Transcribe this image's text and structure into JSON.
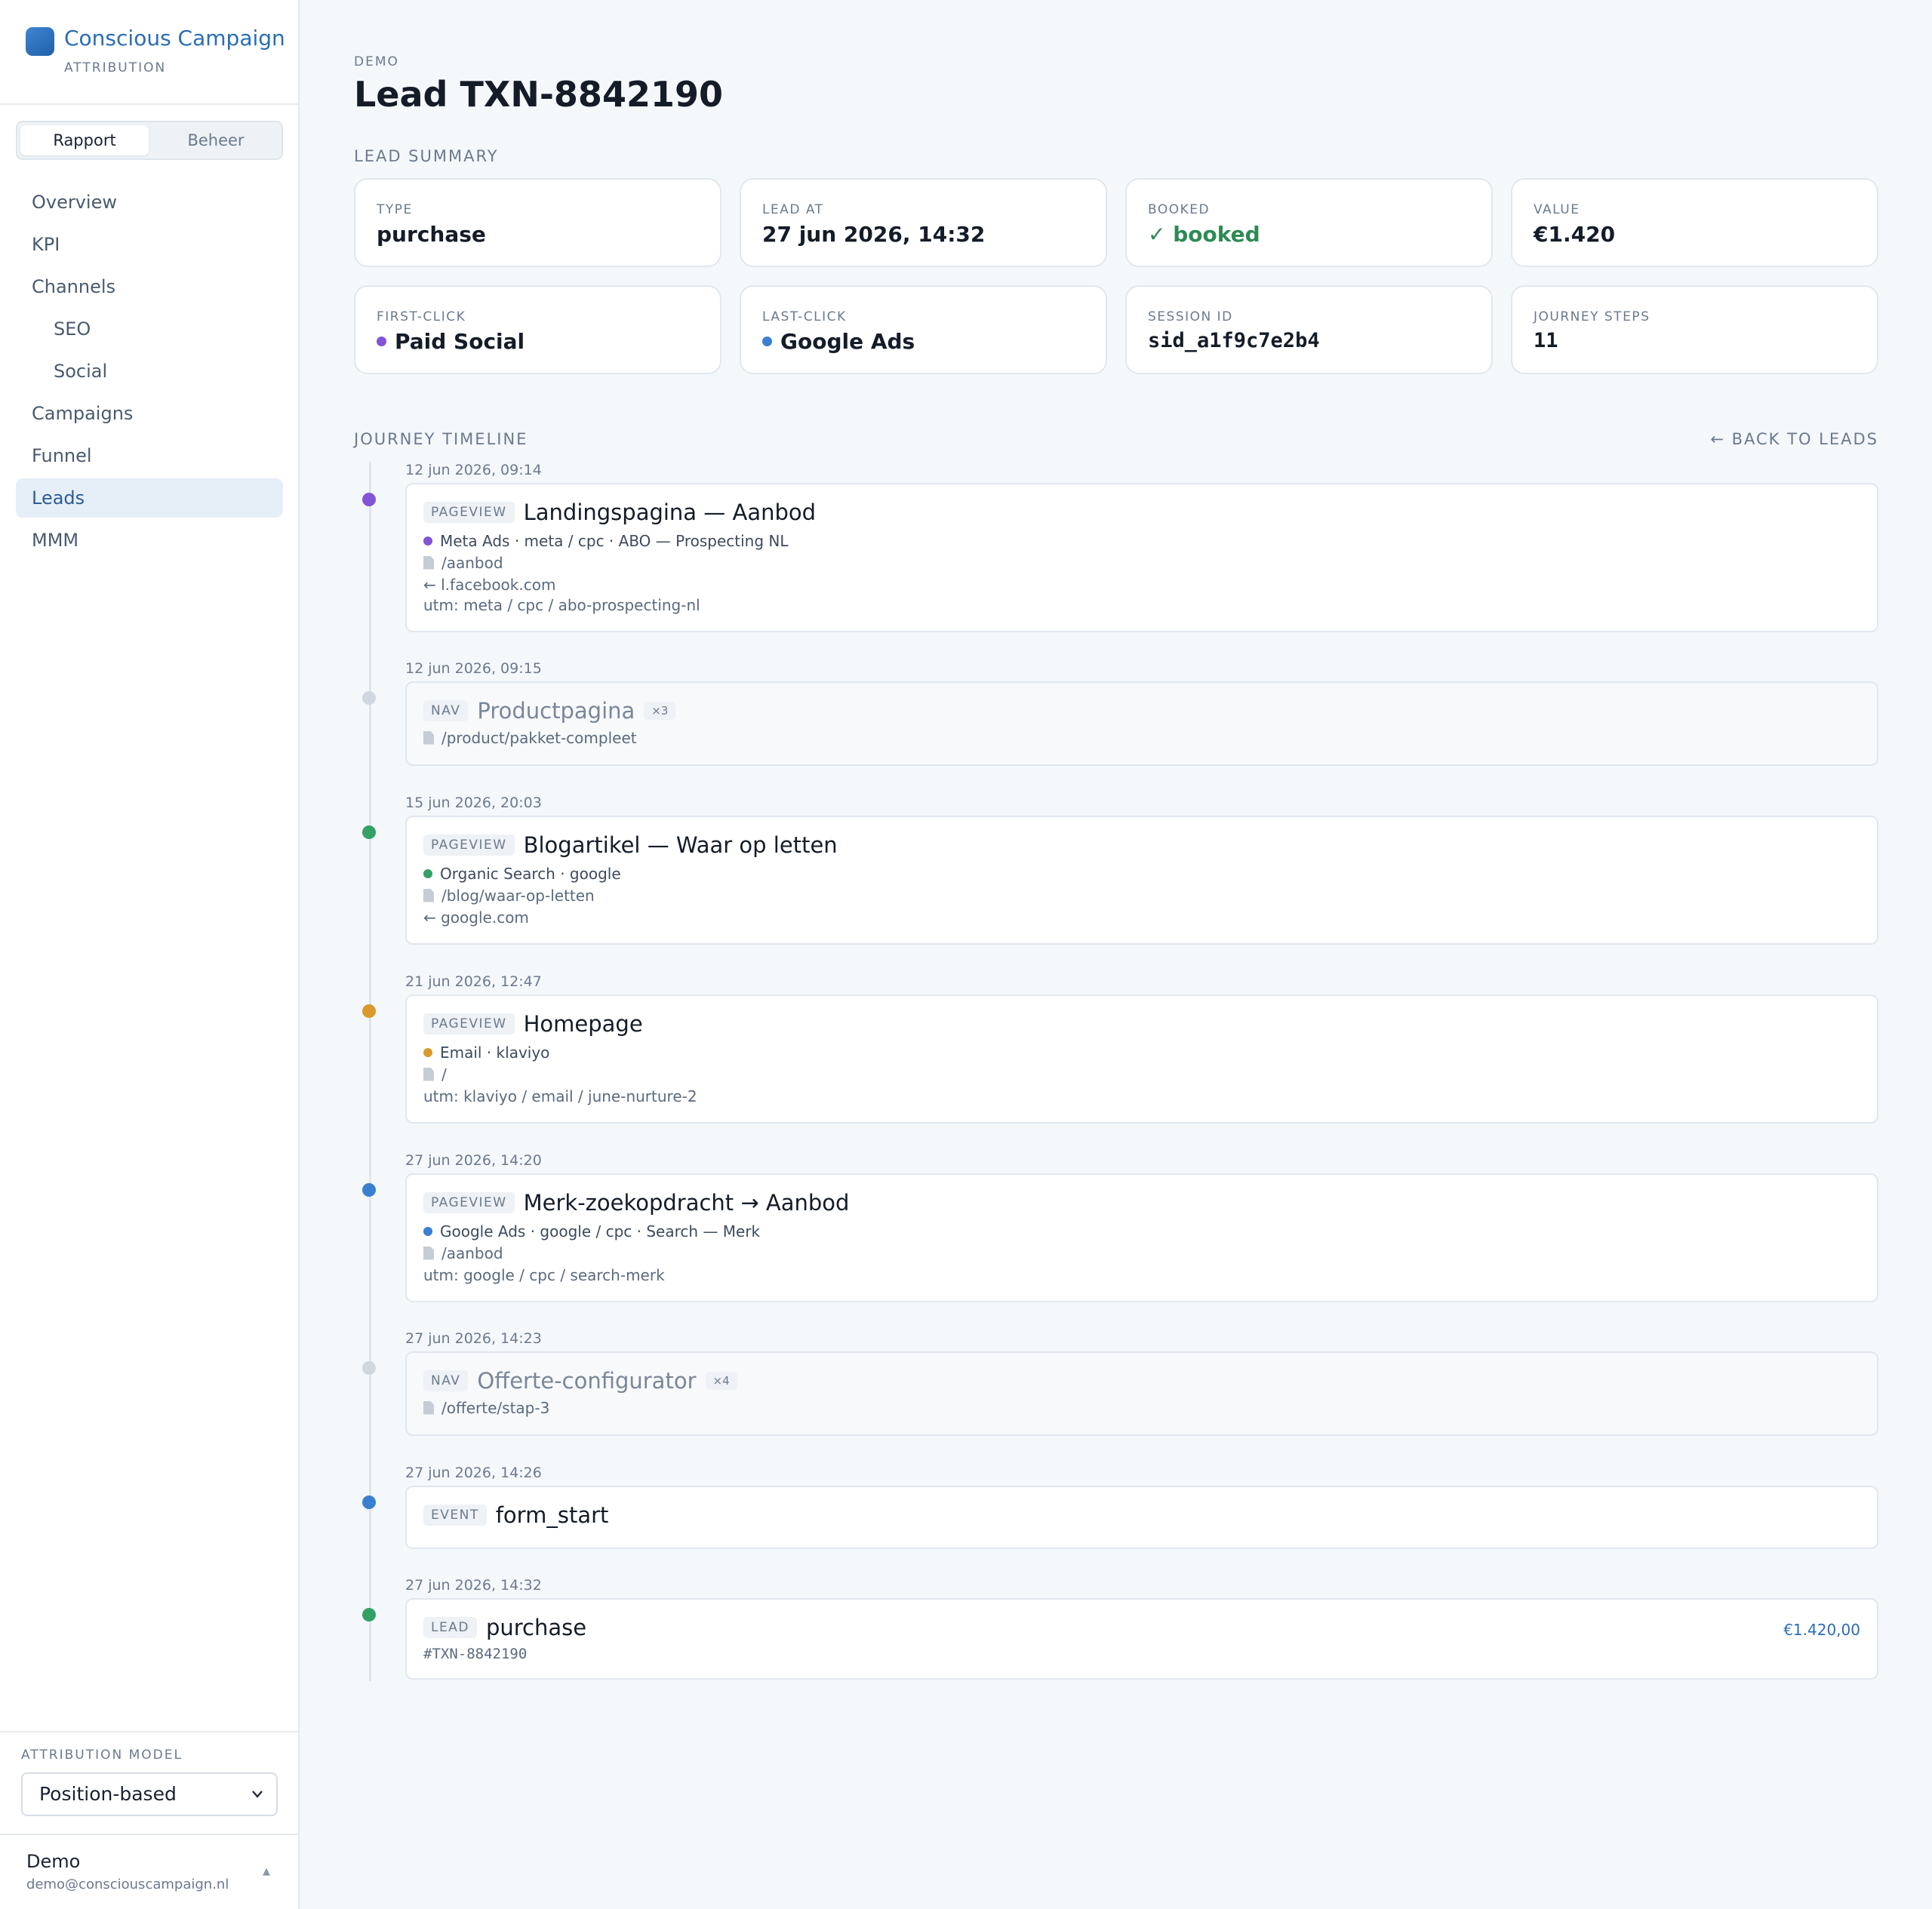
{
  "brand": {
    "name": "Conscious Campaign",
    "subtitle": "ATTRIBUTION"
  },
  "segments": {
    "report": "Rapport",
    "manage": "Beheer"
  },
  "nav": [
    {
      "label": "Overview",
      "sub": false,
      "active": false
    },
    {
      "label": "KPI",
      "sub": false,
      "active": false
    },
    {
      "label": "Channels",
      "sub": false,
      "active": false
    },
    {
      "label": "SEO",
      "sub": true,
      "active": false
    },
    {
      "label": "Social",
      "sub": true,
      "active": false
    },
    {
      "label": "Campaigns",
      "sub": false,
      "active": false
    },
    {
      "label": "Funnel",
      "sub": false,
      "active": false
    },
    {
      "label": "Leads",
      "sub": false,
      "active": true
    },
    {
      "label": "MMM",
      "sub": false,
      "active": false
    }
  ],
  "attribution": {
    "label": "ATTRIBUTION MODEL",
    "selected": "Position-based"
  },
  "user": {
    "name": "Demo",
    "email": "demo@consciouscampaign.nl"
  },
  "header": {
    "eyebrow": "DEMO",
    "title": "Lead TXN-8842190"
  },
  "summary": {
    "section_label": "LEAD SUMMARY",
    "cards": [
      {
        "label": "TYPE",
        "value": "purchase"
      },
      {
        "label": "LEAD AT",
        "value": "27 jun 2026, 14:32"
      },
      {
        "label": "BOOKED",
        "value": "✓ booked"
      },
      {
        "label": "VALUE",
        "value": "€1.420"
      },
      {
        "label": "FIRST-CLICK",
        "value": "Paid Social"
      },
      {
        "label": "LAST-CLICK",
        "value": "Google Ads"
      },
      {
        "label": "SESSION ID",
        "value": "sid_a1f9c7e2b4"
      },
      {
        "label": "JOURNEY STEPS",
        "value": "11"
      }
    ]
  },
  "colors": {
    "paid_social": "#8155d6",
    "google_ads": "#3a7fd0",
    "organic": "#33a065",
    "email": "#d99a2b",
    "nav": "#cfd7e0"
  },
  "timeline": {
    "section_label": "JOURNEY TIMELINE",
    "back_label": "← BACK TO LEADS",
    "events": [
      {
        "time": "12 jun 2026, 09:14",
        "tag": "PAGEVIEW",
        "title": "Landingspagina — Aanbod",
        "source": "Meta Ads · meta / cpc · ABO — Prospecting NL",
        "path": "/aanbod",
        "referrer": "← l.facebook.com",
        "utm": "utm: meta / cpc / abo-prospecting-nl"
      },
      {
        "time": "12 jun 2026, 09:15",
        "tag": "NAV",
        "title": "Productpagina",
        "count": "×3",
        "path": "/product/pakket-compleet"
      },
      {
        "time": "15 jun 2026, 20:03",
        "tag": "PAGEVIEW",
        "title": "Blogartikel — Waar op letten",
        "source": "Organic Search · google",
        "path": "/blog/waar-op-letten",
        "referrer": "← google.com"
      },
      {
        "time": "21 jun 2026, 12:47",
        "tag": "PAGEVIEW",
        "title": "Homepage",
        "source": "Email · klaviyo",
        "path": "/",
        "utm": "utm: klaviyo / email / june-nurture-2"
      },
      {
        "time": "27 jun 2026, 14:20",
        "tag": "PAGEVIEW",
        "title": "Merk-zoekopdracht → Aanbod",
        "source": "Google Ads · google / cpc · Search — Merk",
        "path": "/aanbod",
        "utm": "utm: google / cpc / search-merk"
      },
      {
        "time": "27 jun 2026, 14:23",
        "tag": "NAV",
        "title": "Offerte-configurator",
        "count": "×4",
        "path": "/offerte/stap-3"
      },
      {
        "time": "27 jun 2026, 14:26",
        "tag": "EVENT",
        "title": "form_start"
      },
      {
        "time": "27 jun 2026, 14:32",
        "tag": "LEAD",
        "title": "purchase",
        "ref": "#TXN-8842190",
        "value": "€1.420,00"
      }
    ]
  }
}
